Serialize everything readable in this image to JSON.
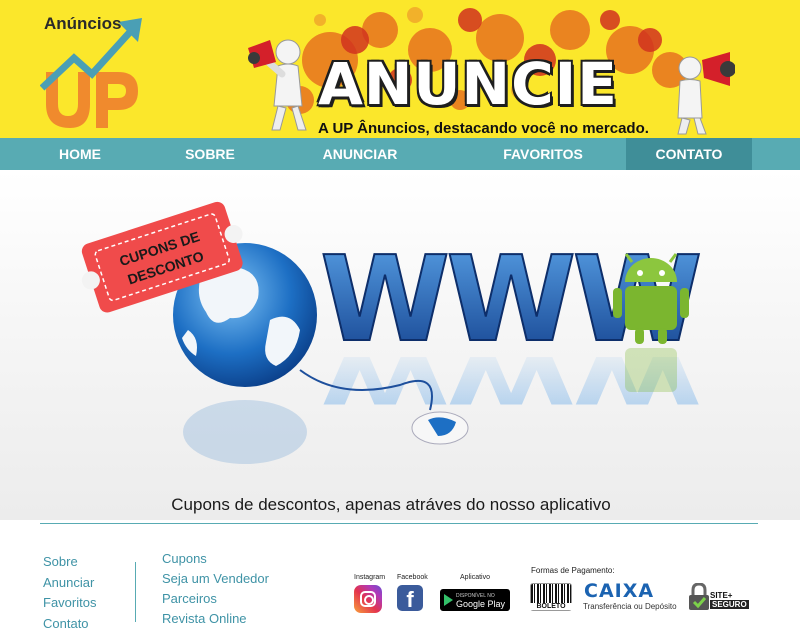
{
  "header": {
    "logo_text": "Anúncios",
    "logo_letters": "UP",
    "brand_title": "ANUNCIE",
    "slogan": "A UP Ânuncios, destacando você no mercado."
  },
  "nav": {
    "items": [
      {
        "label": "HOME"
      },
      {
        "label": "SOBRE"
      },
      {
        "label": "ANUNCIAR"
      },
      {
        "label": "FAVORITOS"
      },
      {
        "label": "CONTATO",
        "active": true
      }
    ]
  },
  "banner": {
    "coupon_text_1": "CUPONS DE",
    "coupon_text_2": "DESCONTO",
    "www_text": "WWW",
    "caption": "Cupons de descontos, apenas atráves do nosso aplicativo"
  },
  "footer": {
    "col1": [
      "Sobre",
      "Anunciar",
      "Favoritos",
      "Contato"
    ],
    "col2": [
      "Cupons",
      "Seja um Vendedor",
      "Parceiros",
      "Revista Online"
    ],
    "social": {
      "instagram_label": "Instagram",
      "facebook_label": "Facebook",
      "app_label": "Aplicativo",
      "gp_small": "DISPONÍVEL NO",
      "gp_text": "Google Play"
    },
    "payment": {
      "title": "Formas de Pagamento:",
      "boleto": "BOLETO",
      "caixa": "CAIXA",
      "caixa_sub": "Transferência ou Depósito",
      "seguro_1": "SITE+",
      "seguro_2": "SEGURO"
    }
  },
  "colors": {
    "header_bg": "#fbe72b",
    "nav_bg": "#58abb3",
    "nav_active": "#3f8e98",
    "link": "#3f93a6"
  },
  "icons": [
    "megaphone-icon",
    "instagram-icon",
    "facebook-icon",
    "google-play-icon",
    "boleto-icon",
    "padlock-icon",
    "android-icon",
    "globe-icon",
    "mouse-icon"
  ]
}
